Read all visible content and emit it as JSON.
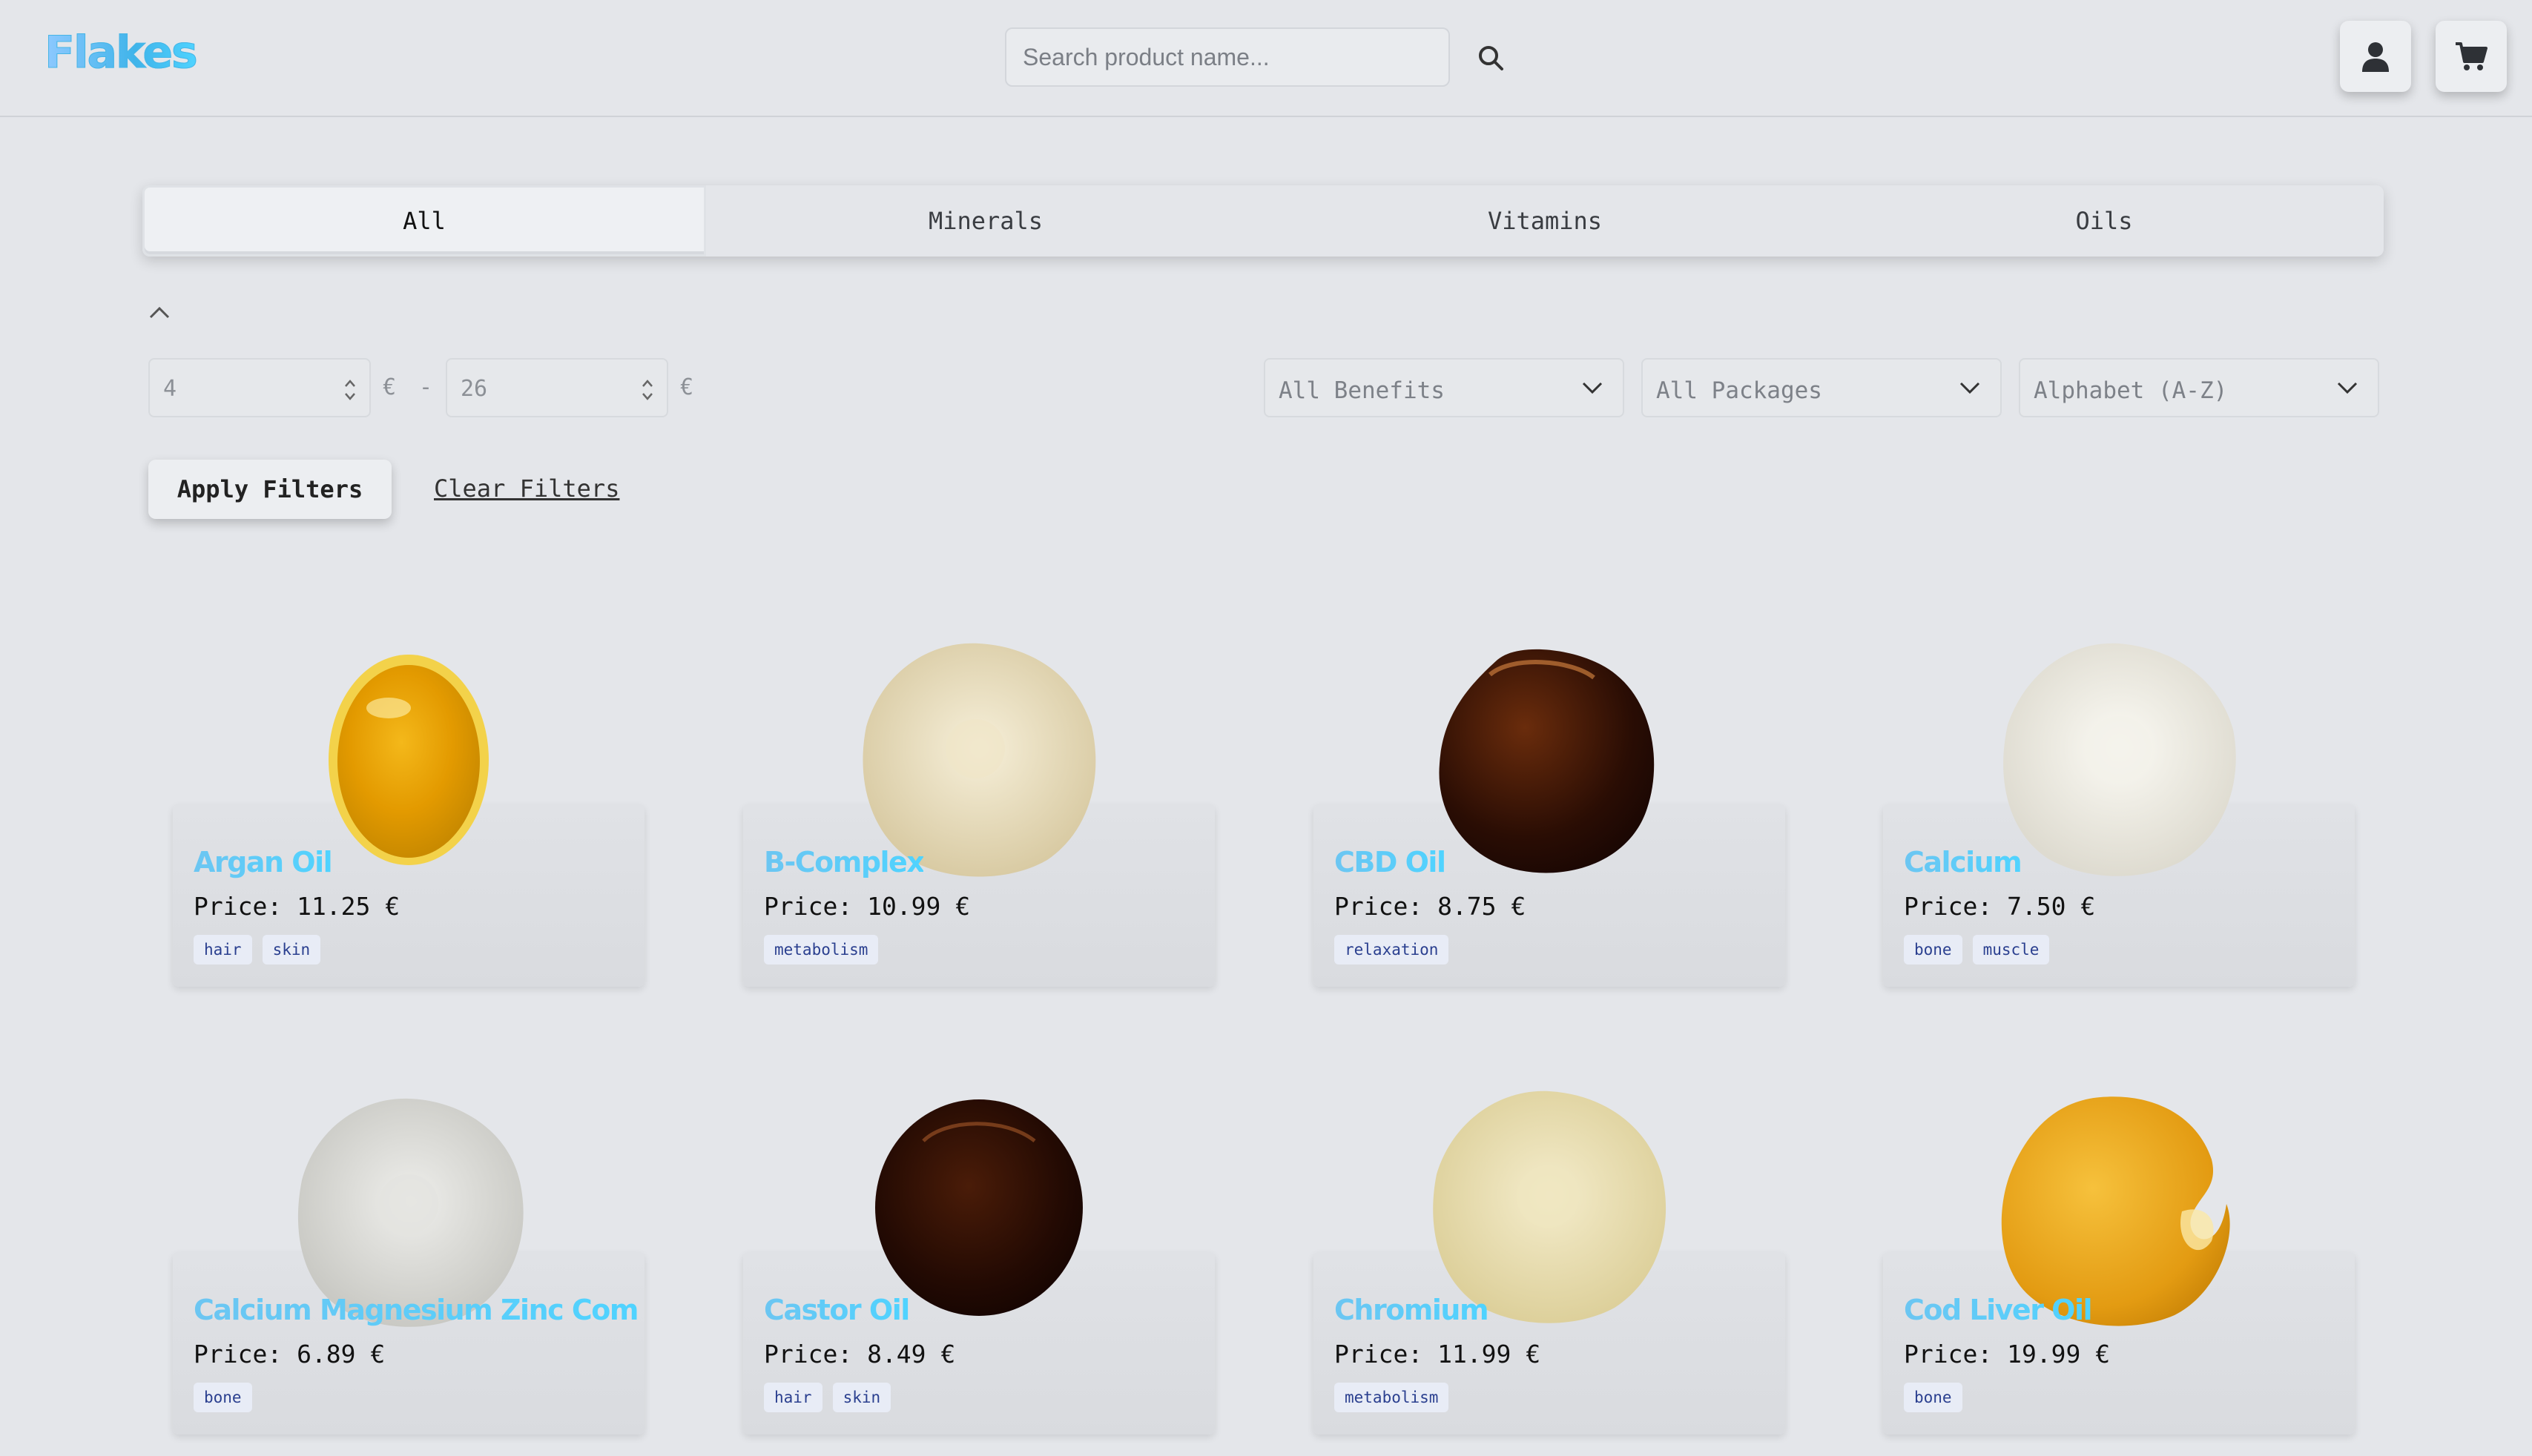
{
  "header": {
    "logo": "Flakes",
    "search_placeholder": "Search product name...",
    "icons": {
      "search": "search-icon",
      "user": "user-icon",
      "cart": "cart-icon"
    }
  },
  "tabs": [
    {
      "label": "All",
      "active": true
    },
    {
      "label": "Minerals",
      "active": false
    },
    {
      "label": "Vitamins",
      "active": false
    },
    {
      "label": "Oils",
      "active": false
    }
  ],
  "filters": {
    "price_min": "4",
    "price_max": "26",
    "currency": "€",
    "separator": "-",
    "benefits": "All Benefits",
    "packages": "All Packages",
    "sort": "Alphabet (A-Z)",
    "apply_label": "Apply Filters",
    "clear_label": "Clear Filters"
  },
  "products": [
    {
      "name": "Argan Oil",
      "price": "Price: 11.25 €",
      "tags": [
        "hair",
        "skin"
      ],
      "image": "golden-oil-capsule"
    },
    {
      "name": "B-Complex",
      "price": "Price: 10.99 €",
      "tags": [
        "metabolism"
      ],
      "image": "beige-powder"
    },
    {
      "name": "CBD Oil",
      "price": "Price: 8.75 €",
      "tags": [
        "relaxation"
      ],
      "image": "dark-oil-drop"
    },
    {
      "name": "Calcium",
      "price": "Price: 7.50 €",
      "tags": [
        "bone",
        "muscle"
      ],
      "image": "white-powder"
    },
    {
      "name": "Calcium Magnesium Zinc Com",
      "price": "Price: 6.89 €",
      "tags": [
        "bone"
      ],
      "image": "grey-powder"
    },
    {
      "name": "Castor Oil",
      "price": "Price: 8.49 €",
      "tags": [
        "hair",
        "skin"
      ],
      "image": "dark-oil-round"
    },
    {
      "name": "Chromium",
      "price": "Price: 11.99 €",
      "tags": [
        "metabolism"
      ],
      "image": "yellow-powder"
    },
    {
      "name": "Cod Liver Oil",
      "price": "Price: 19.99 €",
      "tags": [
        "bone"
      ],
      "image": "honey-oil-drop"
    }
  ],
  "colors": {
    "background": "#e4e6ea",
    "accent": "#4fc3f0",
    "tag_bg": "#e8ecf6",
    "tag_text": "#2a3f8f"
  }
}
